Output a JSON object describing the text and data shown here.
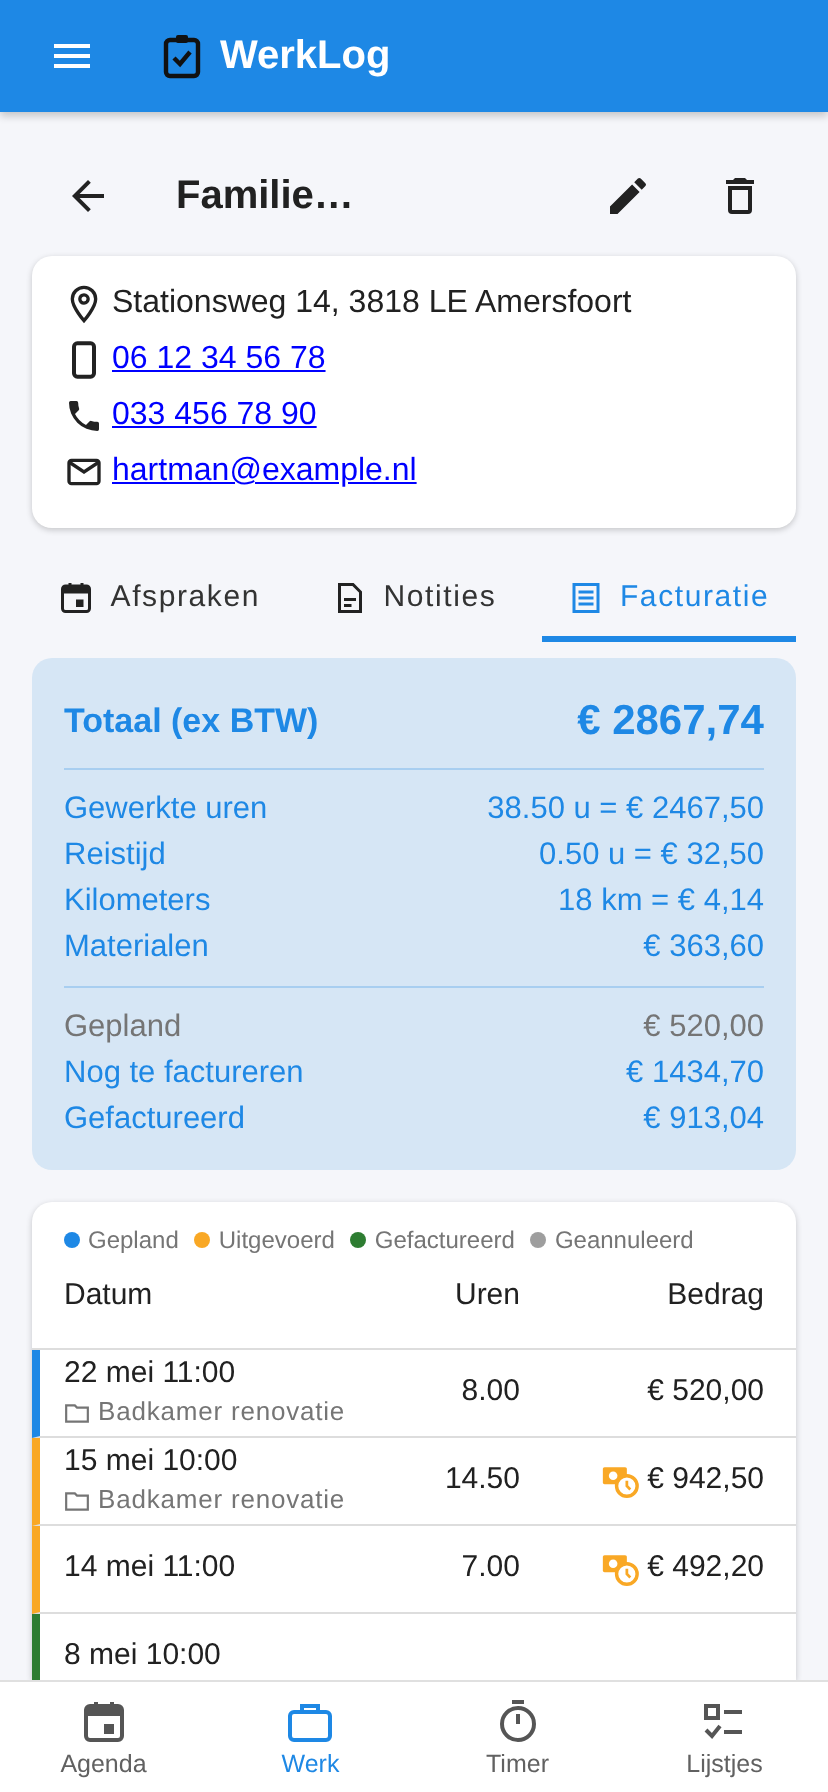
{
  "app_bar": {
    "title": "WerkLog"
  },
  "page": {
    "title": "Familie…"
  },
  "contact": [
    {
      "kind": "address",
      "text": "Stationsweg 14, 3818 LE Amersfoort"
    },
    {
      "kind": "mobile",
      "text": "06 12 34 56 78"
    },
    {
      "kind": "phone",
      "text": "033 456 78 90"
    },
    {
      "kind": "email",
      "text": "hartman@example.nl"
    }
  ],
  "tabs": [
    {
      "label": "Afspraken",
      "selected": false
    },
    {
      "label": "Notities",
      "selected": false
    },
    {
      "label": "Facturatie",
      "selected": true
    }
  ],
  "summary": {
    "total_label": "Totaal (ex BTW)",
    "total_value": "€ 2867,74",
    "sections": [
      [
        {
          "label": "Gewerkte uren",
          "value": "38.50 u = € 2467,50",
          "muted": false
        },
        {
          "label": "Reistijd",
          "value": "0.50 u = € 32,50",
          "muted": false
        },
        {
          "label": "Kilometers",
          "value": "18 km = € 4,14",
          "muted": false
        },
        {
          "label": "Materialen",
          "value": "€ 363,60",
          "muted": false
        }
      ],
      [
        {
          "label": "Gepland",
          "value": "€ 520,00",
          "muted": true
        },
        {
          "label": "Nog te factureren",
          "value": "€ 1434,70",
          "muted": false
        },
        {
          "label": "Gefactureerd",
          "value": "€ 913,04",
          "muted": false
        }
      ]
    ]
  },
  "legend": [
    {
      "label": "Gepland",
      "color": "#1e88e5"
    },
    {
      "label": "Uitgevoerd",
      "color": "#f9a825"
    },
    {
      "label": "Gefactureerd",
      "color": "#2e7d32"
    },
    {
      "label": "Geannuleerd",
      "color": "#9e9e9e"
    }
  ],
  "table": {
    "columns": [
      "Datum",
      "Uren",
      "Bedrag"
    ],
    "rows": [
      {
        "date": "22 mei 11:00",
        "project": "Badkamer renovatie",
        "hours": "8.00",
        "amount": "€ 520,00",
        "color": "#1e88e5",
        "unbilled": false
      },
      {
        "date": "15 mei 10:00",
        "project": "Badkamer renovatie",
        "hours": "14.50",
        "amount": "€ 942,50",
        "color": "#f9a825",
        "unbilled": true
      },
      {
        "date": "14 mei 11:00",
        "hours": "7.00",
        "amount": "€ 492,20",
        "color": "#f9a825",
        "unbilled": true
      },
      {
        "date": "8 mei 10:00",
        "color": "#2e7d32",
        "unbilled": false
      }
    ]
  },
  "bottom_nav": [
    {
      "label": "Agenda",
      "selected": false
    },
    {
      "label": "Werk",
      "selected": true
    },
    {
      "label": "Timer",
      "selected": false
    },
    {
      "label": "Lijstjes",
      "selected": false
    }
  ]
}
